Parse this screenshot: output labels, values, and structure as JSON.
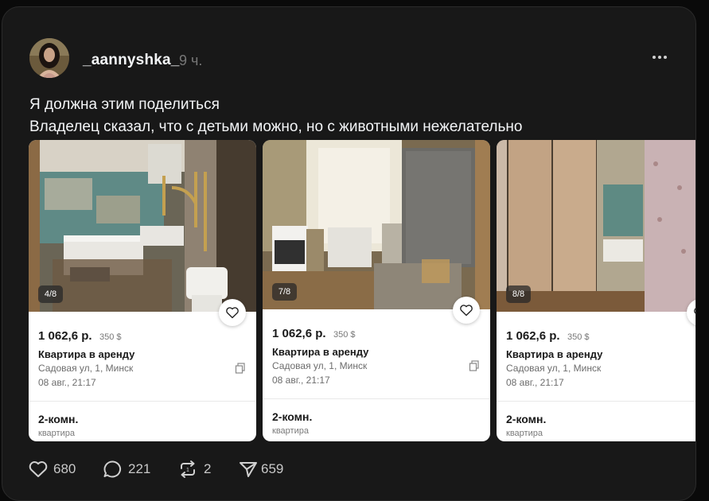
{
  "post": {
    "username": "_aannyshka_",
    "time": "9 ч.",
    "text_line1": "Я должна этим поделиться",
    "text_line2": "Владелец сказал, что с детьми можно, но с животными нежелательно"
  },
  "listings": [
    {
      "badge": "4/8",
      "price": "1 062,6 р.",
      "price_usd": "350 $",
      "title": "Квартира в аренду",
      "address": "Садовая ул, 1, Минск",
      "date": "08 авг., 21:17",
      "rooms": "2-комн.",
      "type": "квартира"
    },
    {
      "badge": "7/8",
      "price": "1 062,6 р.",
      "price_usd": "350 $",
      "title": "Квартира в аренду",
      "address": "Садовая ул, 1, Минск",
      "date": "08 авг., 21:17",
      "rooms": "2-комн.",
      "type": "квартира"
    },
    {
      "badge": "8/8",
      "price": "1 062,6 р.",
      "price_usd": "350 $",
      "title": "Квартира в аренду",
      "address": "Садовая ул, 1, Минск",
      "date": "08 авг., 21:17",
      "rooms": "2-комн.",
      "type": "квартира"
    }
  ],
  "actions": {
    "likes": "680",
    "comments": "221",
    "reposts": "2",
    "shares": "659"
  },
  "icons": {
    "more": "more-dots-icon",
    "like": "heart-icon",
    "comment": "comment-icon",
    "repost": "repost-icon",
    "share": "share-icon",
    "favorite": "heart-outline-icon",
    "copy": "copy-icon"
  },
  "colors": {
    "background": "#0a0a0a",
    "post_bg": "#181818",
    "text": "#f3f5f7",
    "muted": "#777777",
    "card_bg": "#ffffff"
  }
}
